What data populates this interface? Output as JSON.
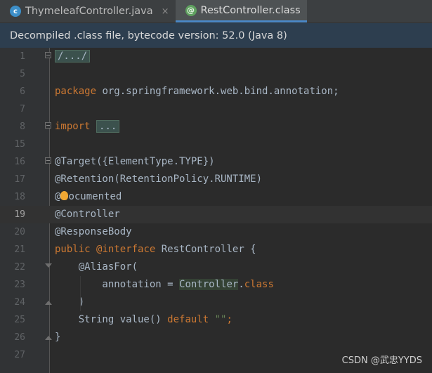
{
  "tabs": [
    {
      "label": "ThymeleafController.java",
      "icon": "java-class-icon",
      "active": false
    },
    {
      "label": "RestController.class",
      "icon": "annotation-icon",
      "active": true
    }
  ],
  "close_glyph": "×",
  "icons": {
    "class_letter": "c",
    "annotation_symbol": "@"
  },
  "banner": "Decompiled .class file, bytecode version: 52.0 (Java 8)",
  "editor": {
    "current_line": "19",
    "lines": [
      {
        "n": "1",
        "parts": [
          {
            "text": "/.../",
            "style": "folded"
          }
        ]
      },
      {
        "n": "5",
        "parts": []
      },
      {
        "n": "6",
        "parts": [
          {
            "text": "package",
            "style": "kw"
          },
          {
            "text": " org.springframework.web.bind.annotation;",
            "style": "plain"
          }
        ]
      },
      {
        "n": "7",
        "parts": []
      },
      {
        "n": "8",
        "parts": [
          {
            "text": "import",
            "style": "kw"
          },
          {
            "text": " ",
            "style": "plain"
          },
          {
            "text": "...",
            "style": "folded"
          }
        ]
      },
      {
        "n": "15",
        "parts": []
      },
      {
        "n": "16",
        "parts": [
          {
            "text": "@Target({ElementType.TYPE})",
            "style": "ann"
          }
        ]
      },
      {
        "n": "17",
        "parts": [
          {
            "text": "@Retention(RetentionPolicy.RUNTIME)",
            "style": "ann"
          }
        ]
      },
      {
        "n": "18",
        "parts": [
          {
            "text": "@",
            "style": "ann"
          },
          {
            "text": "bulb",
            "style": "bulb"
          },
          {
            "text": "ocumented",
            "style": "ann"
          }
        ]
      },
      {
        "n": "19",
        "parts": [
          {
            "text": "@Controller",
            "style": "ann"
          }
        ]
      },
      {
        "n": "20",
        "parts": [
          {
            "text": "@ResponseBody",
            "style": "ann"
          }
        ]
      },
      {
        "n": "21",
        "parts": [
          {
            "text": "public",
            "style": "kw"
          },
          {
            "text": " ",
            "style": "plain"
          },
          {
            "text": "@interface",
            "style": "kw"
          },
          {
            "text": " RestController {",
            "style": "plain"
          }
        ]
      },
      {
        "n": "22",
        "parts": [
          {
            "text": "    @AliasFor(",
            "style": "ann"
          }
        ]
      },
      {
        "n": "23",
        "parts": [
          {
            "text": "        annotation = ",
            "style": "plain"
          },
          {
            "text": "Controller",
            "style": "hl"
          },
          {
            "text": ".",
            "style": "plain"
          },
          {
            "text": "class",
            "style": "kw"
          }
        ]
      },
      {
        "n": "24",
        "parts": [
          {
            "text": "    )",
            "style": "plain"
          }
        ]
      },
      {
        "n": "25",
        "parts": [
          {
            "text": "    String value() ",
            "style": "plain"
          },
          {
            "text": "default",
            "style": "kw"
          },
          {
            "text": " ",
            "style": "plain"
          },
          {
            "text": "\"\"",
            "style": "str"
          },
          {
            "text": ";",
            "style": "kw"
          }
        ]
      },
      {
        "n": "26",
        "parts": [
          {
            "text": "}",
            "style": "plain"
          }
        ]
      },
      {
        "n": "27",
        "parts": []
      }
    ],
    "folds": {
      "1": "box",
      "8": "box",
      "16": "box",
      "22": "down",
      "24": "up",
      "26": "up"
    }
  },
  "watermark": "CSDN @武忠YYDS",
  "colors": {
    "background": "#2b2b2b",
    "keyword": "#cc7832",
    "string": "#6a8759",
    "text": "#a9b7c6",
    "active_tab_underline": "#4a88c7",
    "banner_background": "#2d3e4f"
  }
}
